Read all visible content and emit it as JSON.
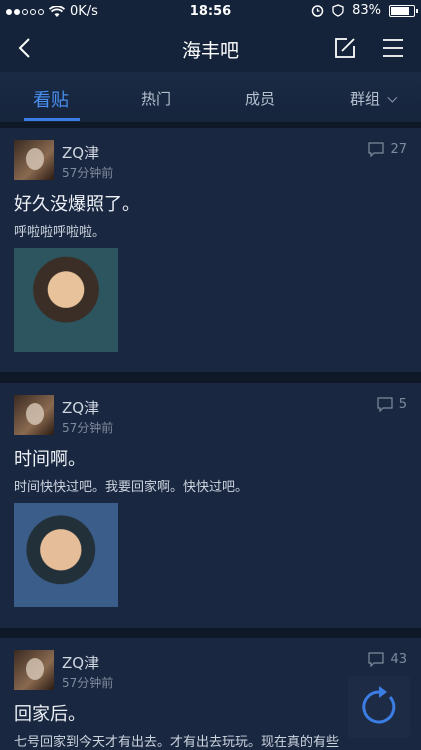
{
  "status_bar": {
    "carrier_speed": "0K/s",
    "time": "18:56",
    "battery": "83%",
    "battery_level": 0.83
  },
  "nav": {
    "title": "海丰吧"
  },
  "tabs": [
    {
      "label": "看贴"
    },
    {
      "label": "热门"
    },
    {
      "label": "成员"
    },
    {
      "label": "群组"
    }
  ],
  "posts": [
    {
      "user": "ZQ津",
      "time": "57分钟前",
      "comments": "27",
      "title": "好久没爆照了。",
      "body": "呼啦啦呼啦啦。"
    },
    {
      "user": "ZQ津",
      "time": "57分钟前",
      "comments": "5",
      "title": "时间啊。",
      "body": "时间快快过吧。我要回家啊。快快过吧。"
    },
    {
      "user": "ZQ津",
      "time": "57分钟前",
      "comments": "43",
      "title": "回家后。",
      "body": "七号回家到今天才有出去。才有出去玩玩。现在真的有些"
    }
  ],
  "colors": {
    "accent": "#3b7de2",
    "background": "#0e1826",
    "card": "#192740"
  }
}
